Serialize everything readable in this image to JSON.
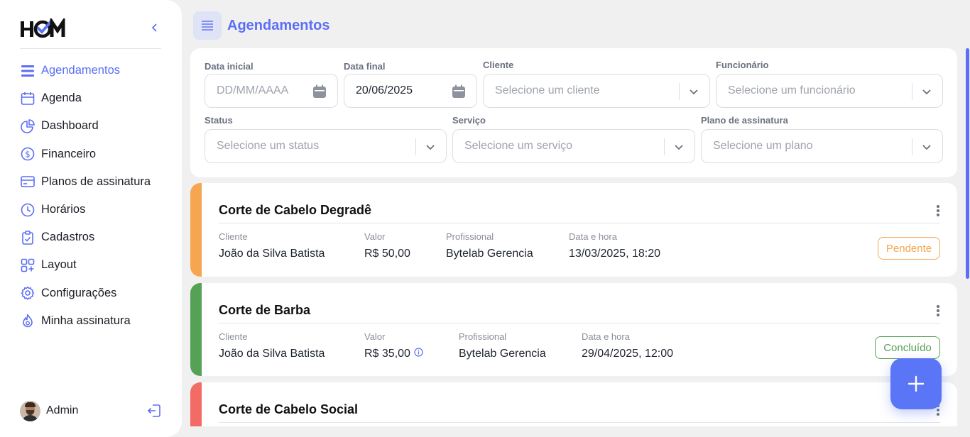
{
  "brand": {
    "logo_text": "HOM"
  },
  "colors": {
    "accent": "#5b6ef5",
    "pending": "#f6a650",
    "done": "#55a155",
    "social": "#f26b64"
  },
  "sidebar": {
    "items": [
      {
        "label": "Agendamentos",
        "icon": "list-icon"
      },
      {
        "label": "Agenda",
        "icon": "calendar-icon"
      },
      {
        "label": "Dashboard",
        "icon": "pie-chart-icon"
      },
      {
        "label": "Financeiro",
        "icon": "dollar-circle-icon"
      },
      {
        "label": "Planos de assinatura",
        "icon": "credit-card-icon"
      },
      {
        "label": "Horários",
        "icon": "clock-icon"
      },
      {
        "label": "Cadastros",
        "icon": "clipboard-icon"
      },
      {
        "label": "Layout",
        "icon": "grid-plus-icon"
      },
      {
        "label": "Configurações",
        "icon": "gear-icon"
      },
      {
        "label": "Minha assinatura",
        "icon": "flame-icon"
      }
    ],
    "user": {
      "name": "Admin"
    }
  },
  "header": {
    "title": "Agendamentos"
  },
  "filters": {
    "start_date": {
      "label": "Data inicial",
      "placeholder": "DD/MM/AAAA"
    },
    "end_date": {
      "label": "Data final",
      "value": "20/06/2025"
    },
    "client": {
      "label": "Cliente",
      "placeholder": "Selecione um cliente"
    },
    "employee": {
      "label": "Funcionário",
      "placeholder": "Selecione um funcionário"
    },
    "status": {
      "label": "Status",
      "placeholder": "Selecione um status"
    },
    "service": {
      "label": "Serviço",
      "placeholder": "Selecione um serviço"
    },
    "plan": {
      "label": "Plano de assinatura",
      "placeholder": "Selecione um plano"
    }
  },
  "labels": {
    "client": "Cliente",
    "value": "Valor",
    "professional": "Profissional",
    "datetime": "Data e hora"
  },
  "appointments": [
    {
      "service": "Corte de Cabelo Degradê",
      "client": "João da Silva Batista",
      "value": "R$ 50,00",
      "professional": "Bytelab Gerencia",
      "datetime": "13/03/2025, 18:20",
      "status": "Pendente"
    },
    {
      "service": "Corte de Barba",
      "client": "João da Silva Batista",
      "value": "R$ 35,00",
      "professional": "Bytelab Gerencia",
      "datetime": "29/04/2025, 12:00",
      "status": "Concluído"
    },
    {
      "service": "Corte de Cabelo Social"
    }
  ]
}
